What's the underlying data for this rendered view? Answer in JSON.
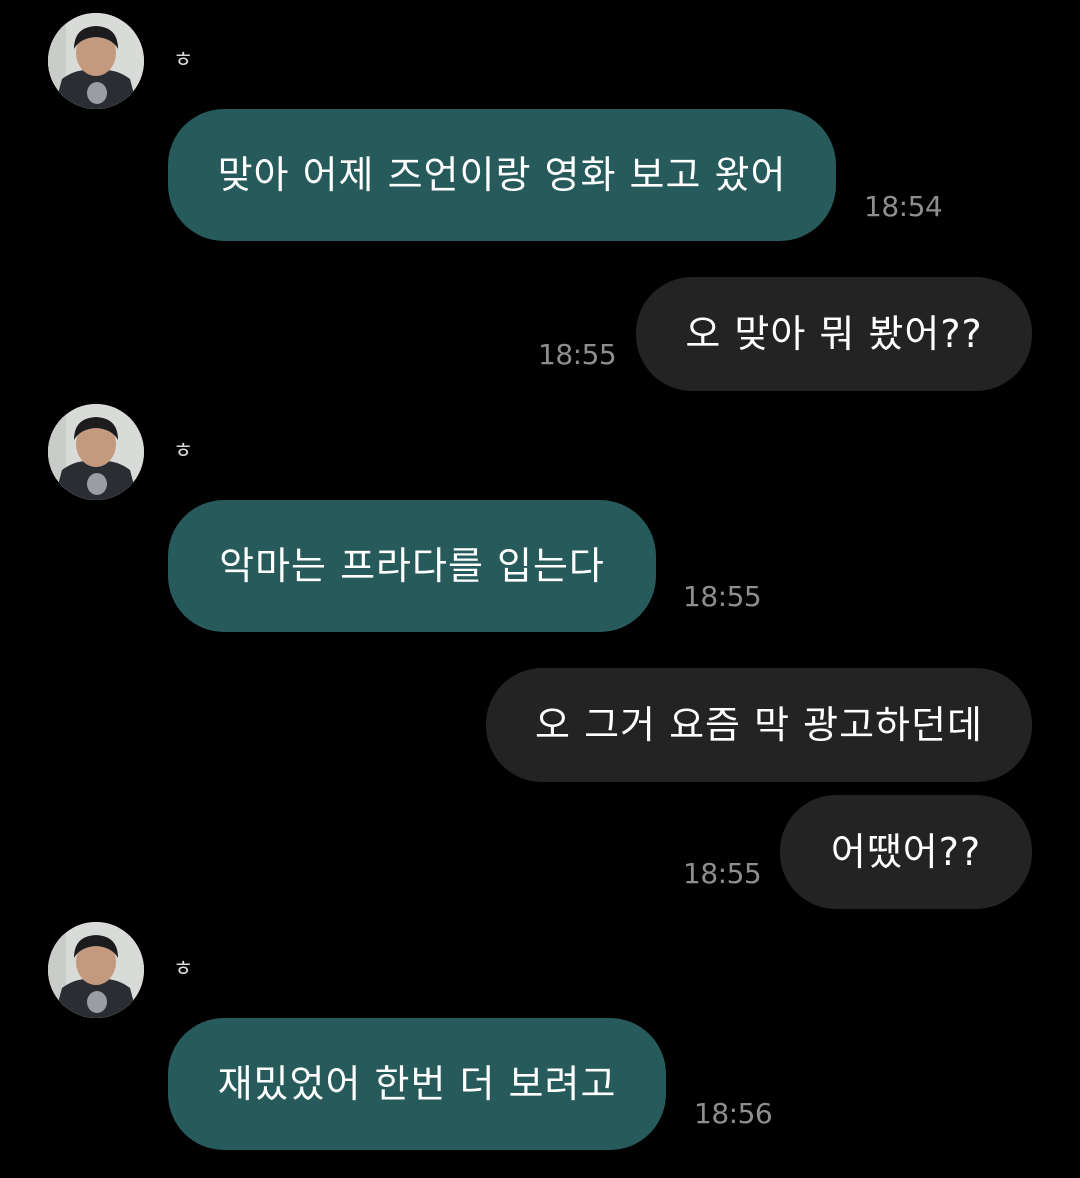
{
  "colors": {
    "background": "#000000",
    "incoming_bubble": "#265a5b",
    "outgoing_bubble": "#232323",
    "timestamp": "#8e8e8e"
  },
  "contact": {
    "name": "ㅎ",
    "avatar_icon": "profile-photo-icon"
  },
  "messages": [
    {
      "direction": "incoming",
      "text": "맞아 어제 즈언이랑 영화 보고 왔어",
      "time": "18:54"
    },
    {
      "direction": "outgoing",
      "text": "오 맞아 뭐 봤어??",
      "time": "18:55"
    },
    {
      "direction": "incoming",
      "text": "악마는 프라다를 입는다",
      "time": "18:55"
    },
    {
      "direction": "outgoing",
      "text": "오 그거 요즘 막 광고하던데",
      "time": ""
    },
    {
      "direction": "outgoing",
      "text": "어땠어??",
      "time": "18:55"
    },
    {
      "direction": "incoming",
      "text": "재밌었어 한번 더 보려고",
      "time": "18:56"
    }
  ]
}
